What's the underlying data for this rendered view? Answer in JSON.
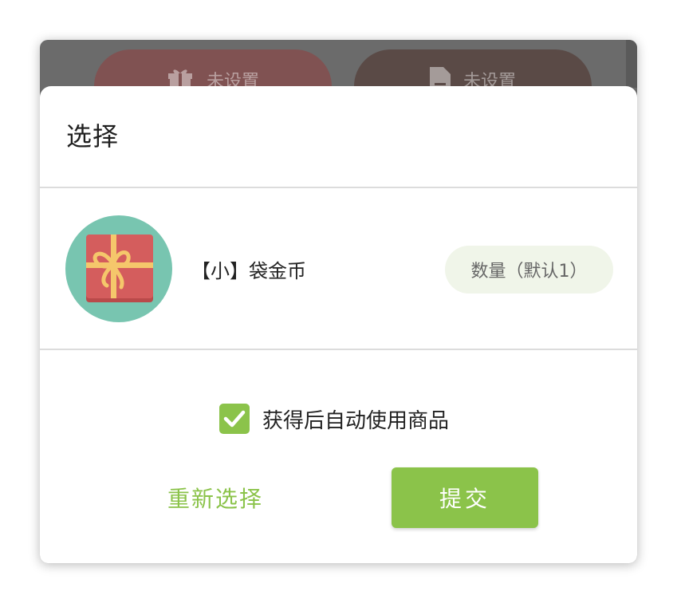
{
  "background": {
    "left_button": {
      "icon": "gift-icon",
      "label": "未设置"
    },
    "right_button": {
      "icon": "document-icon",
      "label": "未设置"
    }
  },
  "dialog": {
    "title": "选择",
    "item": {
      "icon": "gift-box-icon",
      "name": "【小】袋金币",
      "quantity_placeholder": "数量（默认1）"
    },
    "auto_use": {
      "checked": true,
      "label": "获得后自动使用商品"
    },
    "buttons": {
      "reselect": "重新选择",
      "submit": "提交"
    }
  },
  "colors": {
    "accent": "#8bc34a",
    "avatar_bg": "#78c5b0",
    "gift_box": "#d45d5d",
    "ribbon": "#f5c76b",
    "quantity_pill_bg": "#f0f5e9"
  }
}
